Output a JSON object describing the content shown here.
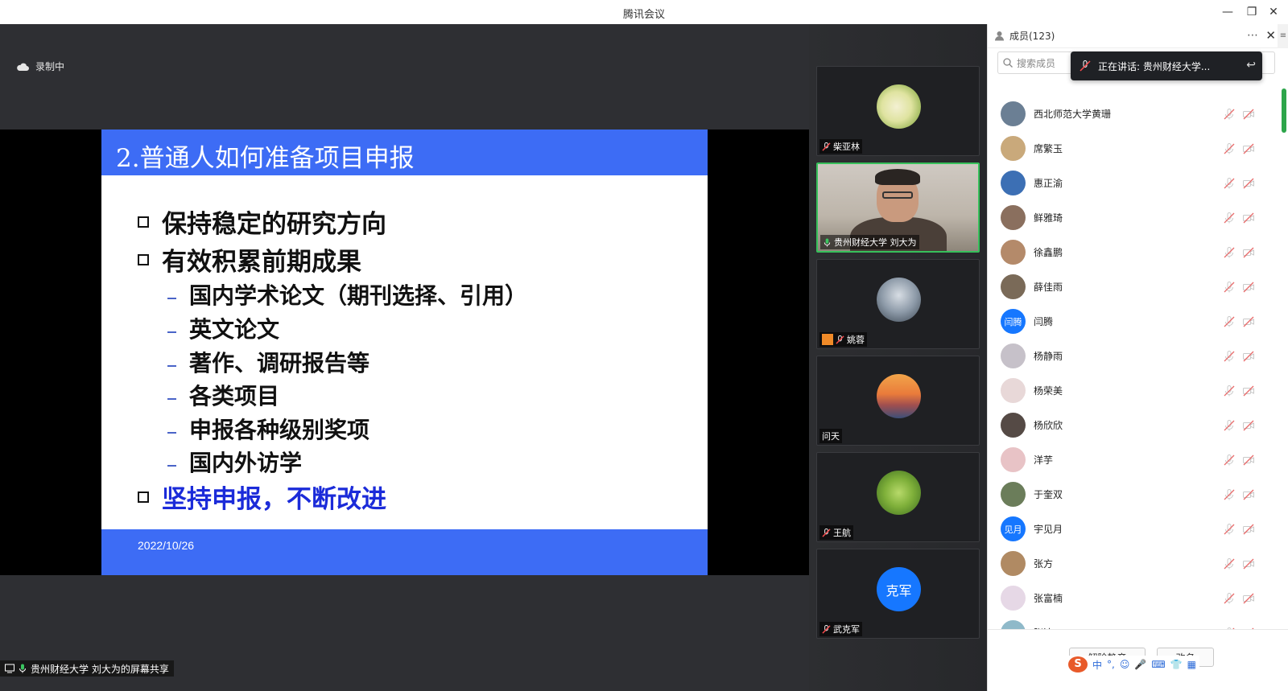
{
  "window": {
    "title": "腾讯会议"
  },
  "stage": {
    "recording_label": "录制中",
    "share_label": "贵州财经大学 刘大为的屏幕共享"
  },
  "slide": {
    "title": "2.普通人如何准备项目申报",
    "bullets": [
      "保持稳定的研究方向",
      "有效积累前期成果"
    ],
    "sub_bullets": [
      "国内学术论文（期刊选择、引用）",
      "英文论文",
      "著作、调研报告等",
      "各类项目",
      "申报各种级别奖项",
      "国内外访学"
    ],
    "highlight_bullet": "坚持申报，不断改进",
    "date": "2022/10/26",
    "accent_color": "#3d6cf5",
    "highlight_color": "#1b2bd9"
  },
  "gallery": [
    {
      "name": "柴亚林",
      "muted": true
    },
    {
      "name": "贵州财经大学 刘大为",
      "muted": false,
      "active": true
    },
    {
      "name": "姚蓉",
      "muted": true
    },
    {
      "name": "问天",
      "muted": false
    },
    {
      "name": "王航",
      "muted": true
    },
    {
      "name": "武克军",
      "muted": true,
      "avatar_text": "克军"
    }
  ],
  "members_panel": {
    "title": "成员(123)",
    "more_icon": "⋯",
    "search_placeholder": "搜索成员",
    "speaking_label": "正在讲话: 贵州财经大学...",
    "members": [
      {
        "name": "西北师范大学黄珊"
      },
      {
        "name": "席繁玉"
      },
      {
        "name": "惠正渝"
      },
      {
        "name": "鲜雅琦"
      },
      {
        "name": "徐鑫鹏"
      },
      {
        "name": "薛佳雨"
      },
      {
        "name": "闫腾",
        "avatar_text": "闫腾"
      },
      {
        "name": "杨静雨"
      },
      {
        "name": "杨荣美"
      },
      {
        "name": "杨欣欣"
      },
      {
        "name": "洋芋"
      },
      {
        "name": "于奎双"
      },
      {
        "name": "宇见月",
        "avatar_text": "见月"
      },
      {
        "name": "张方"
      },
      {
        "name": "张富楠"
      },
      {
        "name": "张洁"
      }
    ],
    "unmute_all_label": "解除静音",
    "rename_label": "改名",
    "ime_label": "中",
    "ime_punct": "°,",
    "ime_logo": "S"
  }
}
